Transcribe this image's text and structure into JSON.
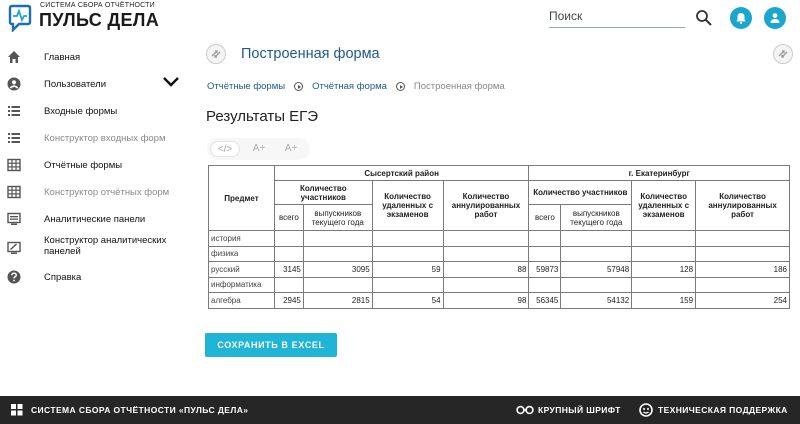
{
  "header": {
    "logo_subtitle": "СИСТЕМА СБОРА ОТЧЁТНОСТИ",
    "logo_title": "ПУЛЬС ДЕЛА",
    "search_placeholder": "Поиск",
    "icons": [
      "search-icon",
      "bell-icon",
      "user-icon"
    ],
    "accent_color": "#1ba6cc"
  },
  "sidebar": {
    "items": [
      {
        "label": "Главная",
        "icon": "home-icon",
        "disabled": false
      },
      {
        "label": "Пользователи",
        "icon": "account-icon",
        "disabled": false
      },
      {
        "label": "Входные формы",
        "icon": "list-icon",
        "disabled": false
      },
      {
        "label": "Конструктор входных форм",
        "icon": "list-icon",
        "disabled": true
      },
      {
        "label": "Отчётные формы",
        "icon": "grid-icon",
        "disabled": false
      },
      {
        "label": "Конструктор отчётных форм",
        "icon": "grid-icon",
        "disabled": true
      },
      {
        "label": "Аналитические панели",
        "icon": "monitor-icon",
        "disabled": false
      },
      {
        "label": "Конструктор аналитических панелей",
        "icon": "monitor-edit-icon",
        "disabled": false
      },
      {
        "label": "Справка",
        "icon": "help-icon",
        "disabled": false
      }
    ]
  },
  "main": {
    "page_title": "Построенная форма",
    "breadcrumbs": [
      "Отчётные формы",
      "Отчётная форма",
      "Построенная форма"
    ],
    "form_title": "Результаты ЕГЭ",
    "toolbar": [
      "</>",
      "A+",
      "A+"
    ],
    "excel_button": "СОХРАНИТЬ В EXCEL"
  },
  "table": {
    "subject_header": "Предмет",
    "districts": [
      "Сысертский район",
      "г. Екатеринбург"
    ],
    "participants_header": "Количество участников",
    "removed_header": "Количество удаленных с экзаменов",
    "annulled_header": "Количество аннулированных работ",
    "sub_all": "всего",
    "sub_graduates": "выпускников текущего года",
    "rows": [
      {
        "subject": "история",
        "v": [
          "",
          "",
          "",
          "",
          "",
          "",
          "",
          ""
        ]
      },
      {
        "subject": "физика",
        "v": [
          "",
          "",
          "",
          "",
          "",
          "",
          "",
          ""
        ]
      },
      {
        "subject": "русский",
        "v": [
          "3145",
          "3095",
          "59",
          "88",
          "59873",
          "57948",
          "128",
          "186"
        ]
      },
      {
        "subject": "информатика",
        "v": [
          "",
          "",
          "",
          "",
          "",
          "",
          "",
          ""
        ]
      },
      {
        "subject": "алгебра",
        "v": [
          "2945",
          "2815",
          "54",
          "98",
          "56345",
          "54132",
          "159",
          "254"
        ]
      }
    ]
  },
  "footer": {
    "system_name": "СИСТЕМА СБОРА ОТЧЁТНОСТИ «ПУЛЬС ДЕЛА»",
    "large_font": "КРУПНЫЙ ШРИФТ",
    "support": "ТЕХНИЧЕСКАЯ ПОДДЕРЖКА"
  }
}
